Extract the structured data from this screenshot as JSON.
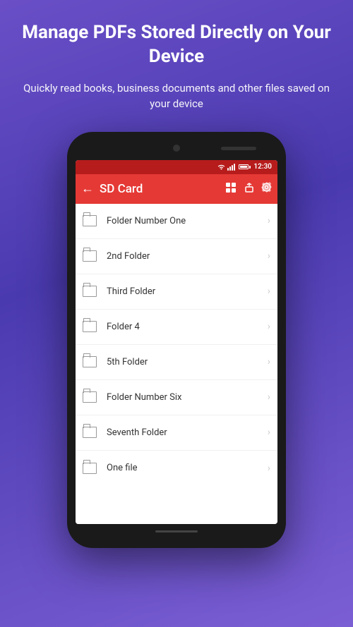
{
  "page": {
    "title": "Manage PDFs Stored Directly on Your Device",
    "subtitle": "Quickly read books, business documents and other files saved on your device"
  },
  "phone": {
    "status_bar": {
      "time": "12:30"
    },
    "toolbar": {
      "title": "SD Card",
      "back_icon": "←",
      "icon1": "☰",
      "icon2": "⬆",
      "icon3": "⚙"
    },
    "file_list": [
      {
        "name": "Folder Number One",
        "type": "folder"
      },
      {
        "name": "2nd Folder",
        "type": "folder"
      },
      {
        "name": "Third Folder",
        "type": "folder"
      },
      {
        "name": "Folder 4",
        "type": "folder"
      },
      {
        "name": "5th Folder",
        "type": "folder"
      },
      {
        "name": "Folder Number Six",
        "type": "folder"
      },
      {
        "name": "Seventh Folder",
        "type": "folder"
      },
      {
        "name": "One file",
        "type": "file"
      }
    ]
  },
  "colors": {
    "background_gradient_start": "#6a4fc7",
    "background_gradient_end": "#7b5ed4",
    "toolbar_bg": "#e53935",
    "status_bar_bg": "#b71c1c"
  }
}
